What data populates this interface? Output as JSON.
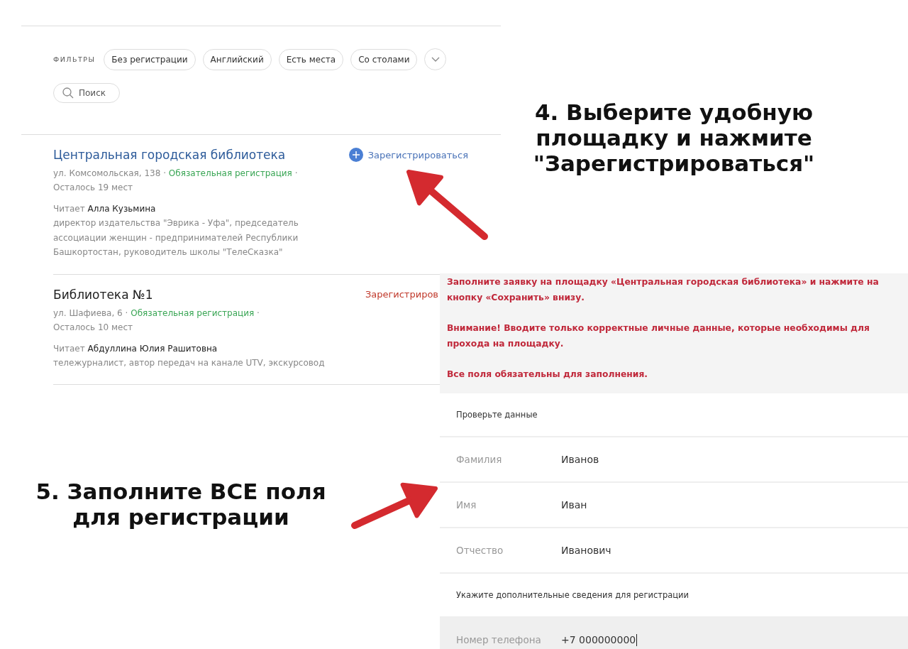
{
  "filters": {
    "label": "ФИЛЬТРЫ",
    "chips": [
      {
        "label": "Без регистрации"
      },
      {
        "label": "Английский"
      },
      {
        "label": "Есть места"
      },
      {
        "label": "Со столами"
      }
    ],
    "search": {
      "placeholder": "Поиск"
    }
  },
  "venues": [
    {
      "title": "Центральная городская библиотека",
      "title_highlighted": true,
      "register": "Зарегистрироваться",
      "register_highlighted": false,
      "separator": "·",
      "address": "ул. Комсомольская, 138",
      "requirement": "Обязательная регистрация",
      "seats": "Осталось 19 мест",
      "reader_label": "Читает",
      "reader": "Алла Кузьмина",
      "bio": "директор издательства \"Эврика - Уфа\", председатель ассоциации женщин - предпринимателей Республики Башкортостан, руководитель школы \"ТелеСказка\""
    },
    {
      "title": "Библиотека №1",
      "title_highlighted": false,
      "register": "Зарегистриров",
      "register_highlighted": true,
      "separator": "·",
      "address": "ул. Шафиева, 6",
      "requirement": "Обязательная регистрация",
      "seats": "Осталось 10 мест",
      "reader_label": "Читает",
      "reader": "Абдуллина Юлия Рашитовна",
      "bio": "тележурналист, автор передач на канале UTV, экскурсовод"
    }
  ],
  "captions": [
    "4. Выберите удобную площадку и нажмите \"Зарегистрироваться\"",
    "5. Заполните ВСЕ поля для регистрации"
  ],
  "form": {
    "notices": [
      "Заполните заявку на площадку «Центральная городская библиотека» и нажмите на кнопку «Сохранить» внизу.",
      "Внимание! Вводите только корректные личные данные, которые необходимы для прохода на площадку.",
      "Все поля обязательны для заполнения."
    ],
    "rows": [
      {
        "kind": "heading",
        "text": "Проверьте данные"
      },
      {
        "kind": "field",
        "label": "Фамилия",
        "value": "Иванов",
        "focused": false
      },
      {
        "kind": "field",
        "label": "Имя",
        "value": "Иван",
        "focused": false
      },
      {
        "kind": "field",
        "label": "Отчество",
        "value": "Иванович",
        "focused": false
      },
      {
        "kind": "heading",
        "text": "Укажите дополнительные сведения для регистрации"
      },
      {
        "kind": "field",
        "label": "Номер телефона",
        "value": "+7 000000000",
        "focused": true
      }
    ]
  }
}
